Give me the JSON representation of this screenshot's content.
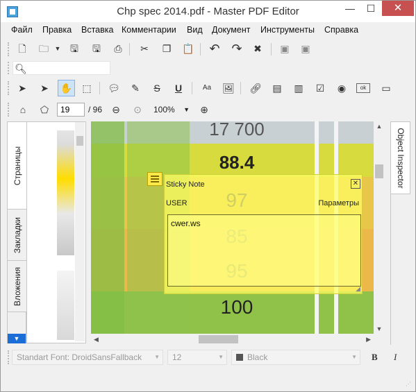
{
  "window": {
    "title": "Chp spec 2014.pdf - Master PDF Editor",
    "minimize": "—",
    "maximize": "☐",
    "close": "✕"
  },
  "menu": [
    "Файл",
    "Правка",
    "Вставка",
    "Комментарии",
    "Вид",
    "Документ",
    "Инструменты",
    "Справка"
  ],
  "search": {
    "placeholder": "",
    "icon": "search-icon"
  },
  "navigation": {
    "current_page": "19",
    "total_pages": "/ 96",
    "zoom": "100%"
  },
  "left_tabs": [
    "Страницы",
    "Закладки",
    "Вложения"
  ],
  "right_tab": "Object Inspector",
  "document": {
    "visible_numbers": [
      "17 700",
      "88.4",
      "97",
      "85",
      "95",
      "100"
    ]
  },
  "sticky_note": {
    "title": "Sticky Note",
    "close": "✕",
    "author": "USER",
    "params": "Параметры",
    "text": "cwer.ws"
  },
  "font_bar": {
    "font": "Standart Font: DroidSansFallback",
    "size": "12",
    "color": "Black",
    "bold": "B",
    "italic": "I"
  },
  "colors": {
    "accent": "#1c6ed6",
    "close_button": "#c75050",
    "note_yellow": "#ffff64"
  }
}
